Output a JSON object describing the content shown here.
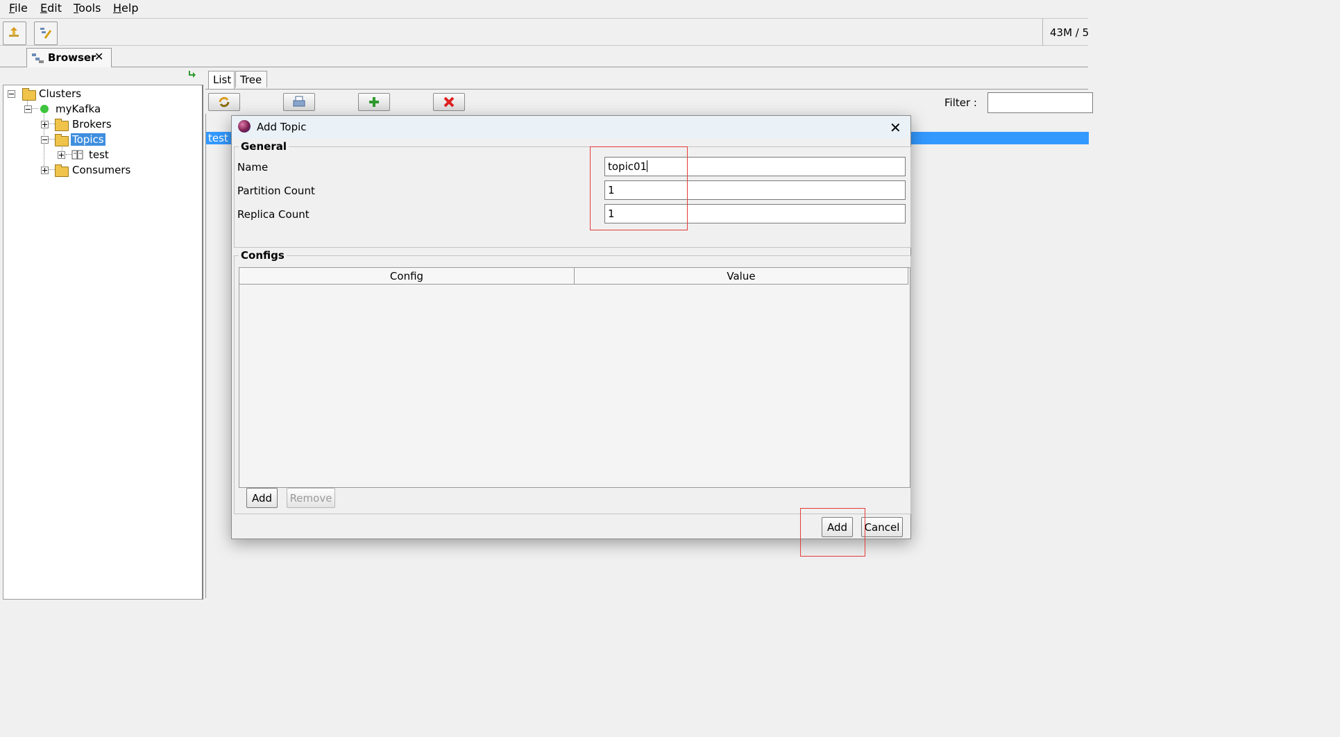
{
  "menubar": {
    "items": [
      {
        "label": "File"
      },
      {
        "label": "Edit"
      },
      {
        "label": "Tools"
      },
      {
        "label": "Help"
      }
    ]
  },
  "toolbar": {
    "memory": "43M / 5"
  },
  "browser_tab": {
    "label": "Browser",
    "close": "✕"
  },
  "tree": {
    "root": "Clusters",
    "cluster": "myKafka",
    "brokers": "Brokers",
    "topics": "Topics",
    "topic_test": "test",
    "consumers": "Consumers"
  },
  "right": {
    "tabs": [
      "List",
      "Tree"
    ],
    "filter_label": "Filter :",
    "filter_value": "",
    "list_rows": [
      "test"
    ]
  },
  "dialog": {
    "title": "Add Topic",
    "close": "✕",
    "general_title": "General",
    "fields": [
      {
        "label": "Name",
        "value": "topic01"
      },
      {
        "label": "Partition Count",
        "value": "1"
      },
      {
        "label": "Replica Count",
        "value": "1"
      }
    ],
    "configs_title": "Configs",
    "columns": [
      "Config",
      "Value"
    ],
    "add_label": "Add",
    "remove_label": "Remove",
    "ok_label": "Add",
    "cancel_label": "Cancel"
  },
  "colors": {
    "selection": "#3399ff",
    "highlight": "#e53a3a"
  }
}
